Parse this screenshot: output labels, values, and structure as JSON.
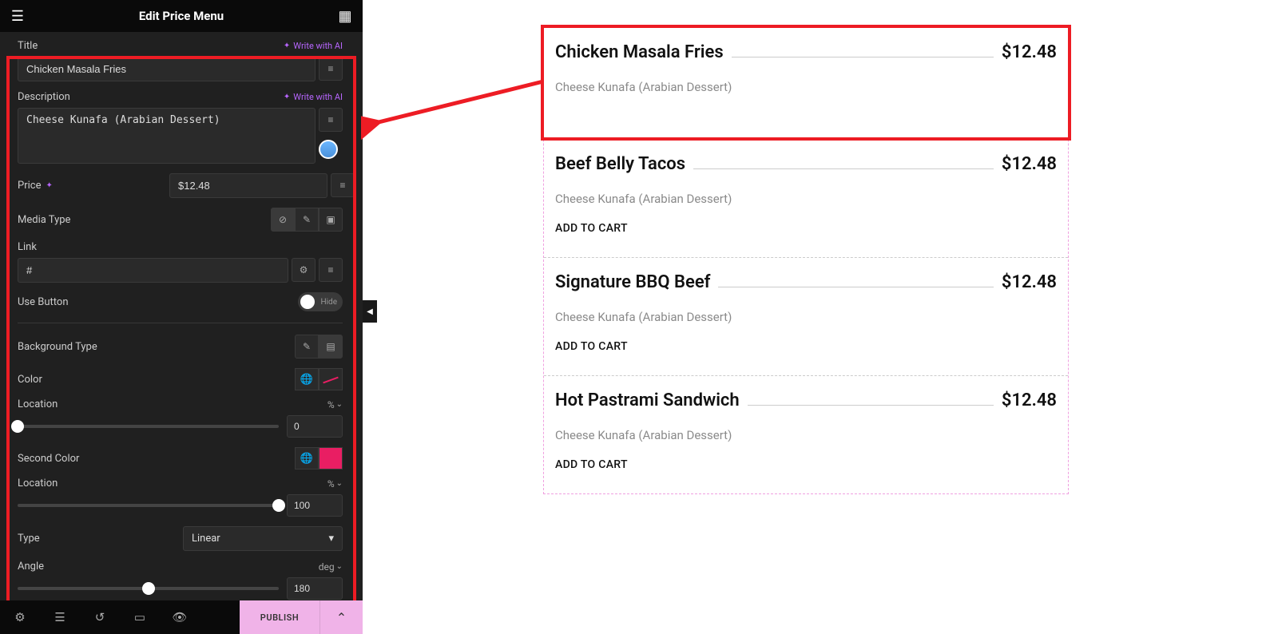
{
  "header": {
    "title": "Edit Price Menu"
  },
  "form": {
    "title_label": "Title",
    "title_value": "Chicken Masala Fries",
    "ai_link": "Write with AI",
    "desc_label": "Description",
    "desc_value": "Cheese Kunafa (Arabian Dessert)",
    "price_label": "Price",
    "price_value": "$12.48",
    "media_label": "Media Type",
    "link_label": "Link",
    "link_value": "#",
    "use_button_label": "Use Button",
    "use_button_state": "Hide",
    "bg_type_label": "Background Type",
    "color_label": "Color",
    "location_label": "Location",
    "location_unit": "%",
    "location_value": "0",
    "second_color_label": "Second Color",
    "location2_value": "100",
    "type_label": "Type",
    "type_value": "Linear",
    "angle_label": "Angle",
    "angle_unit": "deg",
    "angle_value": "180"
  },
  "footer": {
    "publish": "PUBLISH"
  },
  "menu": {
    "items": [
      {
        "title": "Chicken Masala Fries",
        "price": "$12.48",
        "desc": "Cheese Kunafa (Arabian Dessert)",
        "cart": "",
        "selected": true
      },
      {
        "title": "Beef Belly Tacos",
        "price": "$12.48",
        "desc": "Cheese Kunafa (Arabian Dessert)",
        "cart": "ADD TO CART",
        "selected": false
      },
      {
        "title": "Signature BBQ Beef",
        "price": "$12.48",
        "desc": "Cheese Kunafa (Arabian Dessert)",
        "cart": "ADD TO CART",
        "selected": false
      },
      {
        "title": "Hot Pastrami Sandwich",
        "price": "$12.48",
        "desc": "Cheese Kunafa (Arabian Dessert)",
        "cart": "ADD TO CART",
        "selected": false
      }
    ]
  }
}
